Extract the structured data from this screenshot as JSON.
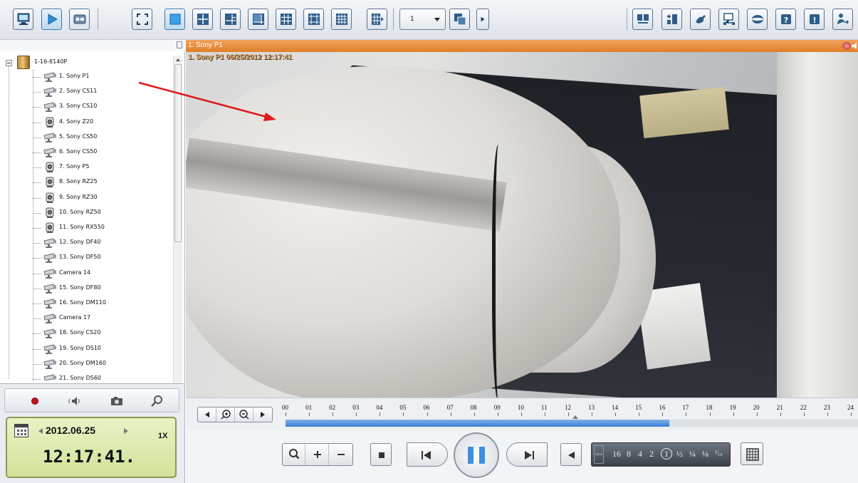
{
  "toolbar": {
    "split_page_value": "1",
    "left_buttons": [
      "live-view",
      "playback",
      "setup"
    ],
    "layout_buttons": [
      "fullscreen",
      "layout-1",
      "layout-4",
      "layout-6",
      "layout-8",
      "layout-9",
      "layout-13",
      "layout-16",
      "layout-more"
    ],
    "right_buttons": [
      "sequence",
      "pip",
      "ptz",
      "network",
      "map",
      "help",
      "about",
      "logout"
    ]
  },
  "tree": {
    "root_label": "1-16-8140P",
    "cameras": [
      {
        "label": "1. Sony P1",
        "icon": "bullet-camera-icon"
      },
      {
        "label": "2. Sony CS11",
        "icon": "bullet-camera-icon"
      },
      {
        "label": "3. Sony CS10",
        "icon": "bullet-camera-icon"
      },
      {
        "label": "4. Sony Z20",
        "icon": "ptz-camera-icon"
      },
      {
        "label": "5. Sony CS50",
        "icon": "bullet-camera-icon"
      },
      {
        "label": "6. Sony CS50",
        "icon": "bullet-camera-icon"
      },
      {
        "label": "7. Sony P5",
        "icon": "ptz-camera-icon"
      },
      {
        "label": "8. Sony RZ25",
        "icon": "ptz-camera-icon"
      },
      {
        "label": "9. Sony RZ30",
        "icon": "ptz-camera-icon"
      },
      {
        "label": "10. Sony RZ50",
        "icon": "ptz-camera-icon"
      },
      {
        "label": "11. Sony RX550",
        "icon": "ptz-camera-icon"
      },
      {
        "label": "12. Sony DF40",
        "icon": "bullet-camera-icon"
      },
      {
        "label": "13. Sony DF50",
        "icon": "bullet-camera-icon"
      },
      {
        "label": "Camera 14",
        "icon": "bullet-camera-icon"
      },
      {
        "label": "15. Sony DF80",
        "icon": "bullet-camera-icon"
      },
      {
        "label": "16. Sony DM110",
        "icon": "bullet-camera-icon"
      },
      {
        "label": "Camera 17",
        "icon": "bullet-camera-icon"
      },
      {
        "label": "18. Sony CS20",
        "icon": "bullet-camera-icon"
      },
      {
        "label": "19. Sony DS10",
        "icon": "bullet-camera-icon"
      },
      {
        "label": "20. Sony DM160",
        "icon": "bullet-camera-icon"
      },
      {
        "label": "21. Sony DS60",
        "icon": "bullet-camera-icon"
      }
    ]
  },
  "control": {
    "date": "2012.06.25",
    "speed": "1X",
    "time": "12:17:41."
  },
  "video": {
    "title": "1. Sony P1",
    "osd": "1. Sony P1 06/25/2012 12:17:41"
  },
  "timeline": {
    "hours": [
      "00",
      "01",
      "02",
      "03",
      "04",
      "05",
      "06",
      "07",
      "08",
      "09",
      "10",
      "11",
      "12",
      "13",
      "14",
      "15",
      "16",
      "17",
      "18",
      "19",
      "20",
      "21",
      "22",
      "23",
      "24"
    ],
    "recorded_until_hour": 16.3,
    "cursor_hour": 12.3
  },
  "playback": {
    "speeds": [
      "16",
      "8",
      "4",
      "2",
      "1",
      "½",
      "¼",
      "⅛",
      "¹⁄₁₆"
    ],
    "selected_speed": "1",
    "sync_label": "Sync"
  },
  "colors": {
    "title_bar": "#e88a35",
    "timeline_fill": "#3a7fd5",
    "pause_accent": "#3f8fe0",
    "annotation_arrow": "#e0181b"
  }
}
